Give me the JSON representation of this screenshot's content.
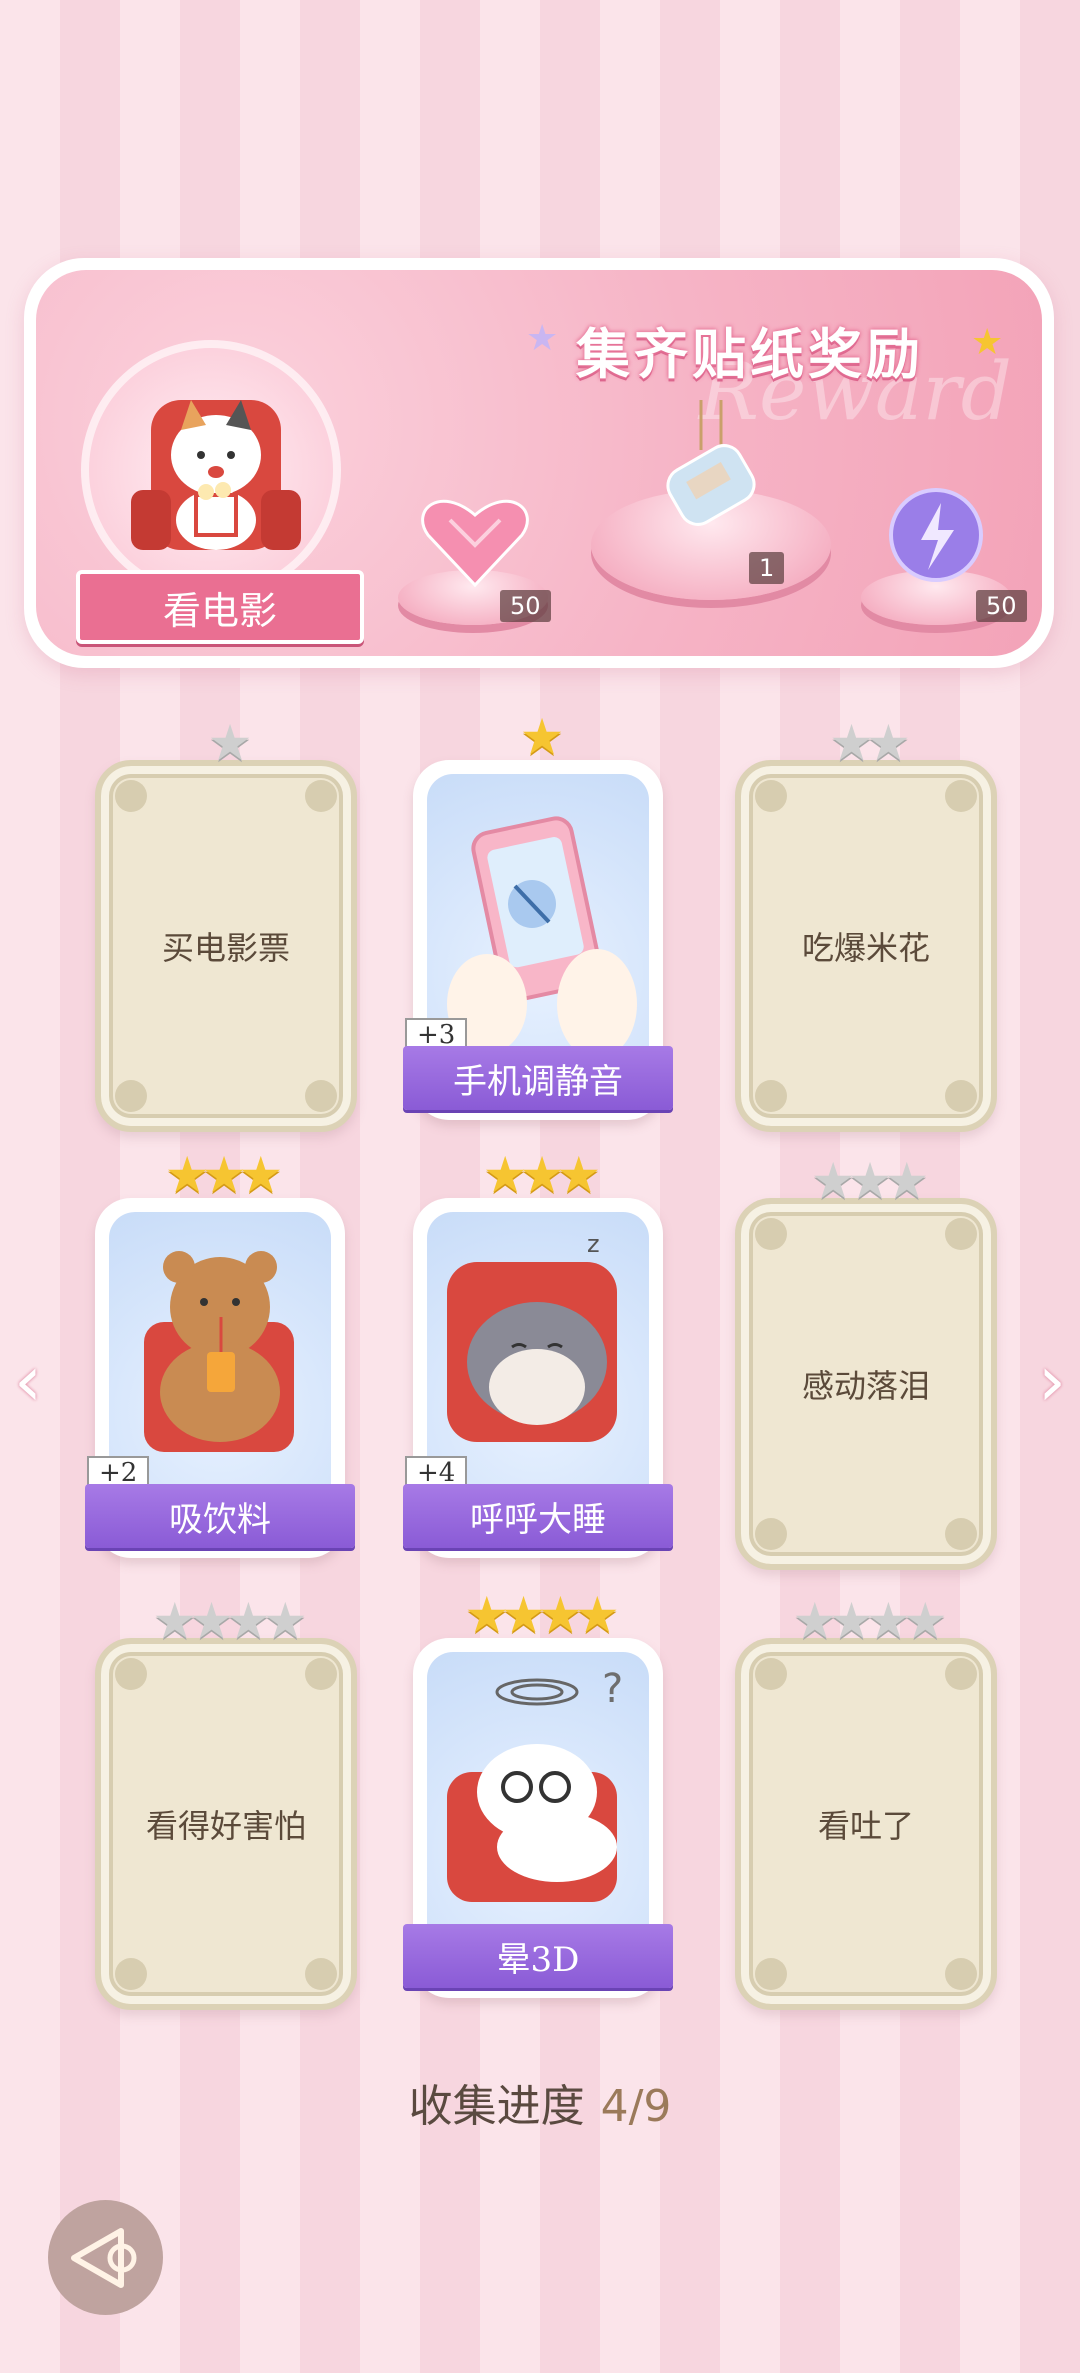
{
  "banner": {
    "title": "集齐贴纸奖励",
    "watermark": "Reward",
    "movie_label": "看电影",
    "rewards": [
      {
        "icon": "pink-heart-gem-icon",
        "count": "50"
      },
      {
        "icon": "bottle-charm-icon",
        "count": "1"
      },
      {
        "icon": "lightning-orb-icon",
        "count": "50"
      }
    ]
  },
  "cards": [
    {
      "label": "买电影票",
      "stars_total": 1,
      "stars_earned": 0,
      "unlocked": false
    },
    {
      "label": "手机调静音",
      "stars_total": 1,
      "stars_earned": 1,
      "unlocked": true,
      "bonus": "+3"
    },
    {
      "label": "吃爆米花",
      "stars_total": 2,
      "stars_earned": 0,
      "unlocked": false
    },
    {
      "label": "吸饮料",
      "stars_total": 3,
      "stars_earned": 3,
      "unlocked": true,
      "bonus": "+2"
    },
    {
      "label": "呼呼大睡",
      "stars_total": 3,
      "stars_earned": 3,
      "unlocked": true,
      "bonus": "+4"
    },
    {
      "label": "感动落泪",
      "stars_total": 3,
      "stars_earned": 0,
      "unlocked": false
    },
    {
      "label": "看得好害怕",
      "stars_total": 4,
      "stars_earned": 0,
      "unlocked": false
    },
    {
      "label": "晕3D",
      "stars_total": 4,
      "stars_earned": 4,
      "unlocked": true
    },
    {
      "label": "看吐了",
      "stars_total": 4,
      "stars_earned": 0,
      "unlocked": false
    }
  ],
  "progress": {
    "label": "收集进度",
    "value": "4/9"
  },
  "colors": {
    "accent": "#ea6f92",
    "label_purple": "#8a5bd6",
    "star_gold": "#f6c531"
  }
}
